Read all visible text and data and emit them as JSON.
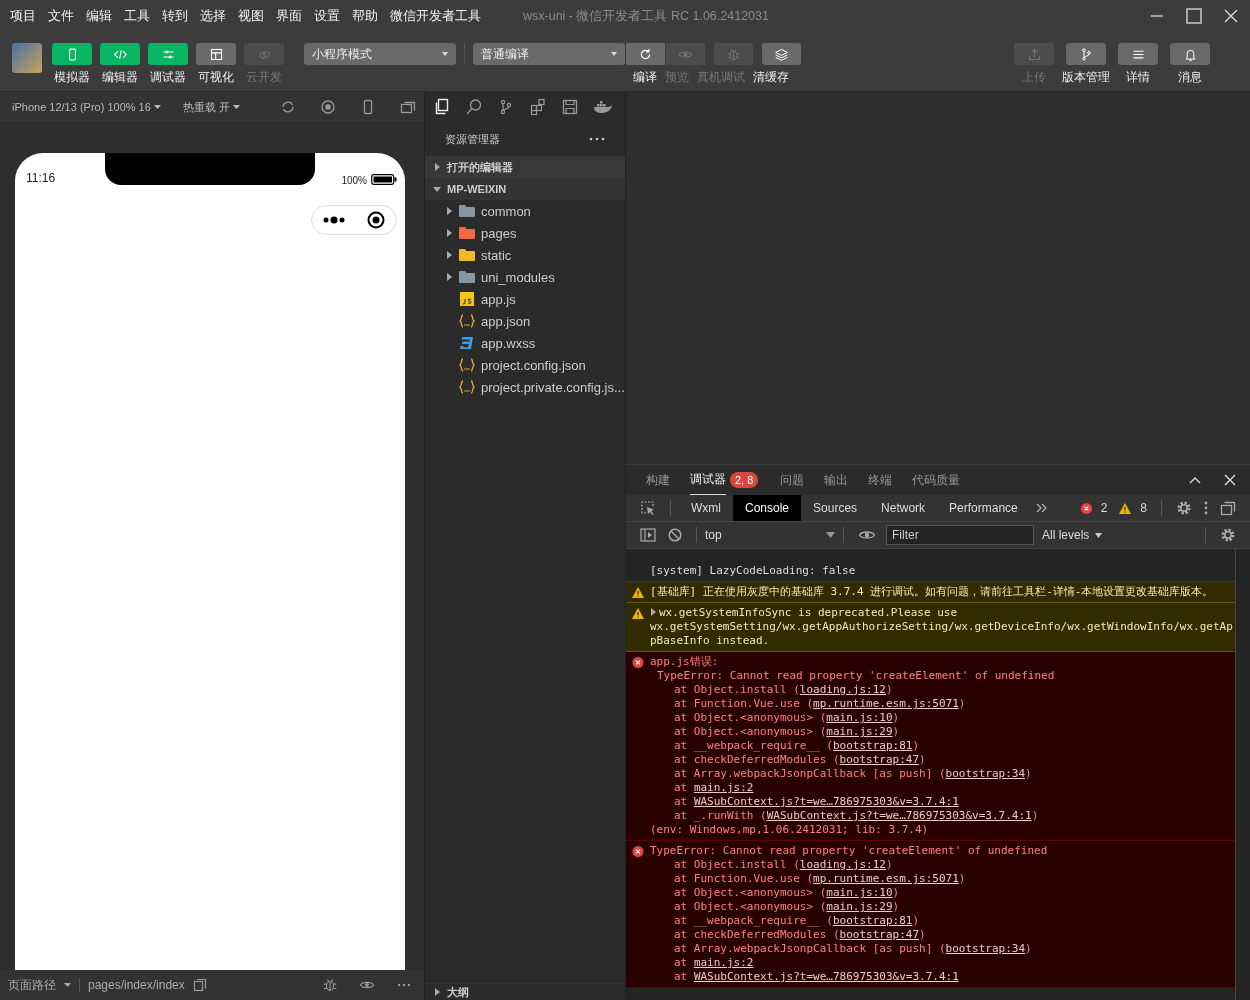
{
  "menu": [
    "项目",
    "文件",
    "编辑",
    "工具",
    "转到",
    "选择",
    "视图",
    "界面",
    "设置",
    "帮助",
    "微信开发者工具"
  ],
  "window": {
    "title": "wsx-uni - 微信开发者工具 RC 1.06.2412031"
  },
  "toolbar": {
    "left_buttons": [
      {
        "label": "模拟器",
        "kind": "phone",
        "disabled": false
      },
      {
        "label": "编辑器",
        "kind": "code",
        "disabled": false
      },
      {
        "label": "调试器",
        "kind": "sliders",
        "disabled": false
      },
      {
        "label": "可视化",
        "kind": "layout",
        "disabled": false
      },
      {
        "label": "云开发",
        "kind": "cloud",
        "disabled": true
      }
    ],
    "mode_select": "小程序模式",
    "compile_select": "普通编译",
    "compile_buttons": [
      {
        "label": "编译",
        "kind": "refresh",
        "disabled": false
      },
      {
        "label": "预览",
        "kind": "eye",
        "disabled": true
      },
      {
        "label": "真机调试",
        "kind": "bug",
        "disabled": true
      },
      {
        "label": "清缓存",
        "kind": "layers",
        "disabled": false
      }
    ],
    "right_buttons": [
      {
        "label": "上传",
        "kind": "upload",
        "disabled": true
      },
      {
        "label": "版本管理",
        "kind": "branch",
        "disabled": false
      },
      {
        "label": "详情",
        "kind": "menu",
        "disabled": false
      },
      {
        "label": "消息",
        "kind": "bell",
        "disabled": false
      }
    ]
  },
  "simulator": {
    "device": "iPhone 12/13 (Pro) 100% 16",
    "hot_reload": "热重载 开",
    "time": "11:16",
    "battery": "100%",
    "path_label": "页面路径",
    "path": "pages/index/index"
  },
  "explorer": {
    "title": "资源管理器",
    "sections": [
      {
        "label": "打开的编辑器",
        "expanded": false
      },
      {
        "label": "MP-WEIXIN",
        "expanded": true,
        "children": [
          {
            "name": "common",
            "kind": "folder",
            "color": "#8796a3",
            "expanded": false
          },
          {
            "name": "pages",
            "kind": "folder",
            "color": "#f06a45",
            "expanded": false
          },
          {
            "name": "static",
            "kind": "folder",
            "color": "#f5b928",
            "expanded": false
          },
          {
            "name": "uni_modules",
            "kind": "folder",
            "color": "#8796a3",
            "expanded": false
          },
          {
            "name": "app.js",
            "kind": "js"
          },
          {
            "name": "app.json",
            "kind": "json"
          },
          {
            "name": "app.wxss",
            "kind": "wxss"
          },
          {
            "name": "project.config.json",
            "kind": "json"
          },
          {
            "name": "project.private.config.js...",
            "kind": "json"
          }
        ]
      }
    ],
    "outline": {
      "label": "大纲",
      "expanded": false
    }
  },
  "devtools": {
    "panel_tabs": [
      {
        "label": "构建",
        "selected": false
      },
      {
        "label": "调试器",
        "selected": true,
        "badge": "2, 8"
      },
      {
        "label": "问题",
        "selected": false
      },
      {
        "label": "输出",
        "selected": false
      },
      {
        "label": "终端",
        "selected": false
      },
      {
        "label": "代码质量",
        "selected": false
      }
    ],
    "tabs": [
      {
        "label": "Wxml",
        "selected": false
      },
      {
        "label": "Console",
        "selected": true
      },
      {
        "label": "Sources",
        "selected": false
      },
      {
        "label": "Network",
        "selected": false
      },
      {
        "label": "Performance",
        "selected": false
      }
    ],
    "error_count": "2",
    "warning_count": "8",
    "context": "top",
    "filter_placeholder": "Filter",
    "levels": "All levels",
    "messages": [
      {
        "kind": "log",
        "text": "[system] LazyCodeLoading: false"
      },
      {
        "kind": "warning",
        "text": "[基础库] 正在使用灰度中的基础库 3.7.4 进行调试。如有问题，请前往工具栏-详情-本地设置更改基础库版本。"
      },
      {
        "kind": "warning",
        "expanded": false,
        "text": "wx.getSystemInfoSync is deprecated.Please use wx.getSystemSetting/wx.getAppAuthorizeSetting/wx.getDeviceInfo/wx.getWindowInfo/wx.getAppBaseInfo instead."
      },
      {
        "kind": "error",
        "title": "app.js错误:",
        "message": "TypeError: Cannot read property 'createElement' of undefined",
        "stack": [
          {
            "pre": "at Object.install (",
            "link": "loading.js:12",
            "post": ")"
          },
          {
            "pre": "at Function.Vue.use (",
            "link": "mp.runtime.esm.js:5071",
            "post": ")"
          },
          {
            "pre": "at Object.<anonymous> (",
            "link": "main.js:10",
            "post": ")"
          },
          {
            "pre": "at Object.<anonymous> (",
            "link": "main.js:29",
            "post": ")"
          },
          {
            "pre": "at __webpack_require__ (",
            "link": "bootstrap:81",
            "post": ")"
          },
          {
            "pre": "at checkDeferredModules (",
            "link": "bootstrap:47",
            "post": ")"
          },
          {
            "pre": "at Array.webpackJsonpCallback [as push] (",
            "link": "bootstrap:34",
            "post": ")"
          },
          {
            "pre": "at ",
            "link": "main.js:2"
          },
          {
            "pre": "at ",
            "link": "WASubContext.js?t=we…786975303&v=3.7.4:1"
          },
          {
            "pre": "at _.runWith (",
            "link": "WASubContext.js?t=we…786975303&v=3.7.4:1",
            "post": ")"
          }
        ],
        "env": "(env: Windows,mp,1.06.2412031; lib: 3.7.4)"
      },
      {
        "kind": "error",
        "title": "TypeError: Cannot read property 'createElement' of undefined",
        "stack": [
          {
            "pre": "at Object.install (",
            "link": "loading.js:12",
            "post": ")"
          },
          {
            "pre": "at Function.Vue.use (",
            "link": "mp.runtime.esm.js:5071",
            "post": ")"
          },
          {
            "pre": "at Object.<anonymous> (",
            "link": "main.js:10",
            "post": ")"
          },
          {
            "pre": "at Object.<anonymous> (",
            "link": "main.js:29",
            "post": ")"
          },
          {
            "pre": "at __webpack_require__ (",
            "link": "bootstrap:81",
            "post": ")"
          },
          {
            "pre": "at checkDeferredModules (",
            "link": "bootstrap:47",
            "post": ")"
          },
          {
            "pre": "at Array.webpackJsonpCallback [as push] (",
            "link": "bootstrap:34",
            "post": ")"
          },
          {
            "pre": "at ",
            "link": "main.js:2"
          },
          {
            "pre": "at ",
            "link": "WASubContext.js?t=we…786975303&v=3.7.4:1"
          }
        ]
      }
    ]
  }
}
